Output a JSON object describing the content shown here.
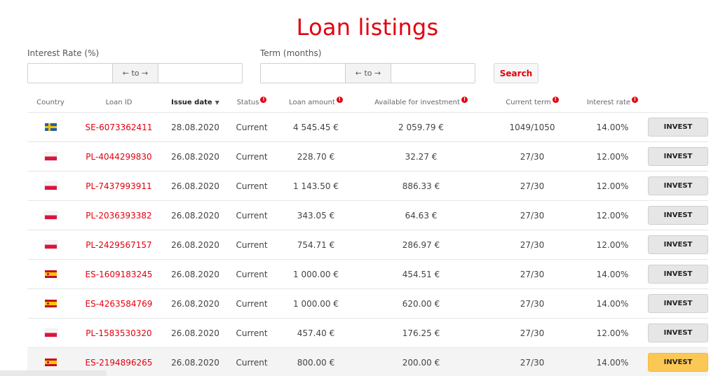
{
  "page": {
    "title": "Loan listings"
  },
  "filters": {
    "interest_label": "Interest Rate (%)",
    "term_label": "Term (months)",
    "range_separator": "← to →",
    "search_label": "Search"
  },
  "table": {
    "headers": {
      "country": "Country",
      "loan_id": "Loan ID",
      "issue_date": "Issue date",
      "status": "Status",
      "loan_amount": "Loan amount",
      "available": "Available for investment",
      "current_term": "Current term",
      "interest_rate": "Interest rate"
    },
    "invest_label": "INVEST",
    "rows": [
      {
        "country": "se",
        "loan_id": "SE-6073362411",
        "issue_date": "28.08.2020",
        "status": "Current",
        "loan_amount": "4 545.45 €",
        "available": "2 059.79 €",
        "term": "1049/1050",
        "rate": "14.00%"
      },
      {
        "country": "pl",
        "loan_id": "PL-4044299830",
        "issue_date": "26.08.2020",
        "status": "Current",
        "loan_amount": "228.70 €",
        "available": "32.27 €",
        "term": "27/30",
        "rate": "12.00%"
      },
      {
        "country": "pl",
        "loan_id": "PL-7437993911",
        "issue_date": "26.08.2020",
        "status": "Current",
        "loan_amount": "1 143.50 €",
        "available": "886.33 €",
        "term": "27/30",
        "rate": "12.00%"
      },
      {
        "country": "pl",
        "loan_id": "PL-2036393382",
        "issue_date": "26.08.2020",
        "status": "Current",
        "loan_amount": "343.05 €",
        "available": "64.63 €",
        "term": "27/30",
        "rate": "12.00%"
      },
      {
        "country": "pl",
        "loan_id": "PL-2429567157",
        "issue_date": "26.08.2020",
        "status": "Current",
        "loan_amount": "754.71 €",
        "available": "286.97 €",
        "term": "27/30",
        "rate": "12.00%"
      },
      {
        "country": "es",
        "loan_id": "ES-1609183245",
        "issue_date": "26.08.2020",
        "status": "Current",
        "loan_amount": "1 000.00 €",
        "available": "454.51 €",
        "term": "27/30",
        "rate": "14.00%"
      },
      {
        "country": "es",
        "loan_id": "ES-4263584769",
        "issue_date": "26.08.2020",
        "status": "Current",
        "loan_amount": "1 000.00 €",
        "available": "620.00 €",
        "term": "27/30",
        "rate": "14.00%"
      },
      {
        "country": "pl",
        "loan_id": "PL-1583530320",
        "issue_date": "26.08.2020",
        "status": "Current",
        "loan_amount": "457.40 €",
        "available": "176.25 €",
        "term": "27/30",
        "rate": "12.00%"
      },
      {
        "country": "es",
        "loan_id": "ES-2194896265",
        "issue_date": "26.08.2020",
        "status": "Current",
        "loan_amount": "800.00 €",
        "available": "200.00 €",
        "term": "27/30",
        "rate": "14.00%"
      }
    ]
  },
  "colors": {
    "accent": "#e3000f",
    "invest_hover": "#fcc855",
    "invest_default": "#e6e6e6"
  },
  "icons": {
    "info": "info-icon",
    "sort": "sort-down-icon"
  }
}
